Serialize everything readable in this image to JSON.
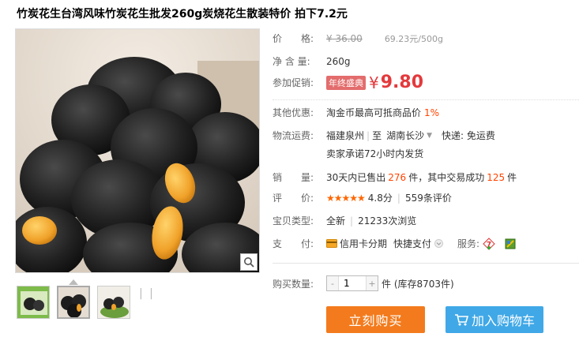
{
  "title": "竹炭花生台湾风味竹炭花生批发260g炭烧花生散装特价 拍下7.2元",
  "price": {
    "label": "价　　格:",
    "original": "¥ 36.00",
    "per_unit": "69.23元/500g"
  },
  "net_weight": {
    "label": "净 含 量:",
    "value": "260g"
  },
  "promo": {
    "label": "参加促销:",
    "tag": "年终盛典",
    "currency": "¥",
    "price": "9.80"
  },
  "other_offer": {
    "label": "其他优惠:",
    "text": "淘金币最高可抵商品价",
    "percent": "1%"
  },
  "logistics": {
    "label": "物流运费:",
    "from": "福建泉州",
    "to_prefix": "至",
    "destination": "湖南长沙",
    "express": "快递: 免运费",
    "promise": "卖家承诺72小时内发货"
  },
  "sales": {
    "label": "销　　量:",
    "prefix": "30天内已售出",
    "sold": "276",
    "middle": "件，其中交易成功",
    "success": "125",
    "suffix": "件"
  },
  "rating": {
    "label": "评　　价:",
    "stars": "★★★★★",
    "score": "4.8分",
    "reviews": "559条评价"
  },
  "item_type": {
    "label": "宝贝类型:",
    "condition": "全新",
    "views": "21233次浏览"
  },
  "payment": {
    "label": "支　　付:",
    "credit": "信用卡分期",
    "quick": "快捷支付",
    "service_label": "服务:"
  },
  "quantity": {
    "label": "购买数量:",
    "value": "1",
    "stock": "件 (库存8703件)"
  },
  "buttons": {
    "buy": "立刻购买",
    "cart": "加入购物车"
  },
  "colors": {
    "accent_red": "#e4393c",
    "buy_orange": "#f37b1d",
    "cart_blue": "#40a8e7"
  }
}
